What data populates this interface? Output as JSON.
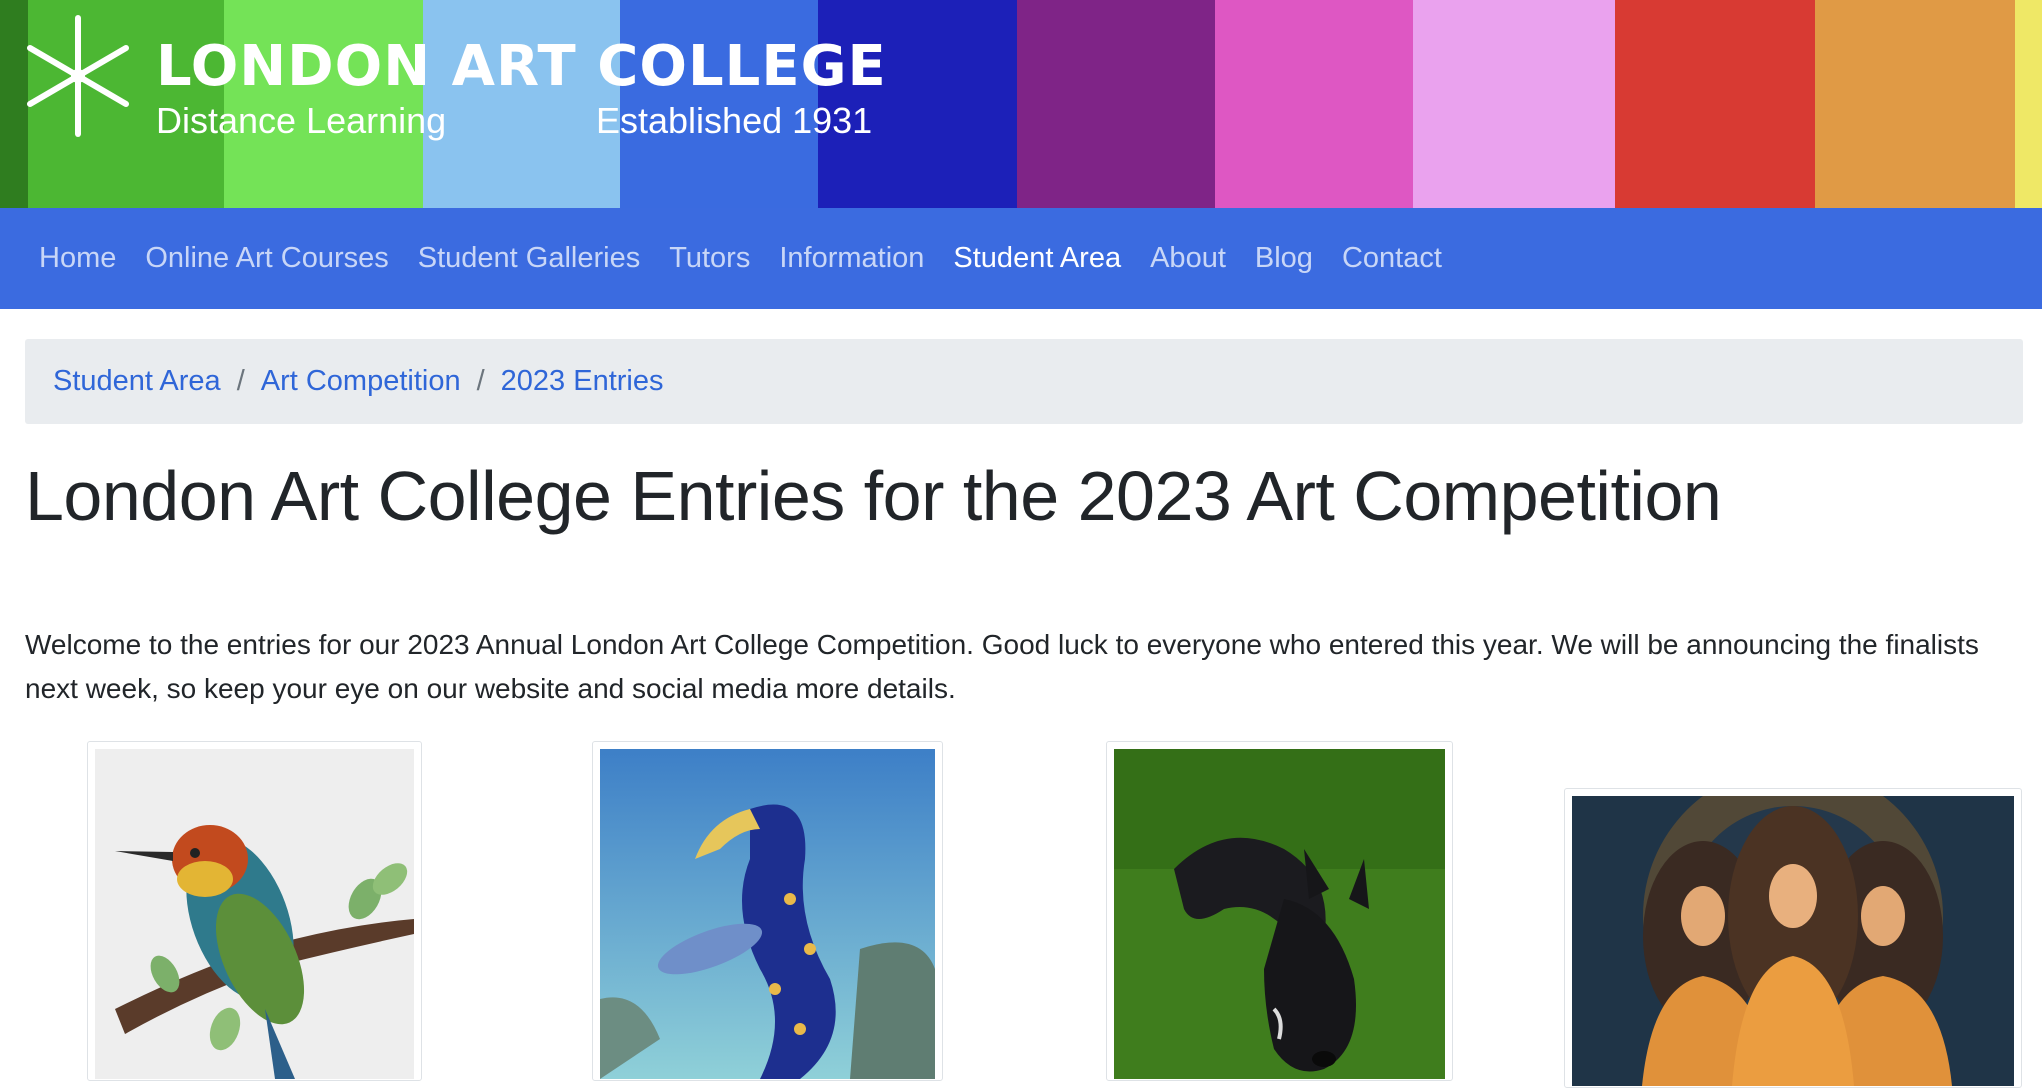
{
  "header": {
    "brand_title": "LONDON ART COLLEGE",
    "brand_subtitle": "Distance Learning",
    "brand_established": "Established 1931",
    "stripe_colors": [
      "#2f7d1f",
      "#4cb733",
      "#74e357",
      "#8ac3ef",
      "#3a6be0",
      "#1c20b8",
      "#7f2487",
      "#de57c3",
      "#eaa2ee",
      "#d83a33",
      "#e09a45",
      "#efe866"
    ]
  },
  "nav": {
    "items": [
      {
        "label": "Home",
        "active": false
      },
      {
        "label": "Online Art Courses",
        "active": false
      },
      {
        "label": "Student Galleries",
        "active": false
      },
      {
        "label": "Tutors",
        "active": false
      },
      {
        "label": "Information",
        "active": false
      },
      {
        "label": "Student Area",
        "active": true
      },
      {
        "label": "About",
        "active": false
      },
      {
        "label": "Blog",
        "active": false
      },
      {
        "label": "Contact",
        "active": false
      }
    ]
  },
  "breadcrumb": {
    "items": [
      "Student Area",
      "Art Competition",
      "2023 Entries"
    ],
    "separator": "/"
  },
  "main": {
    "title": "London Art College Entries for the 2023 Art Competition",
    "intro": "Welcome to the entries for our 2023 Annual London Art College Competition. Good luck to everyone who entered this year. We will be announcing the finalists next week, so keep your eye on our website and social media more details."
  },
  "gallery": {
    "items": [
      {
        "subject": "bird-painting"
      },
      {
        "subject": "sea-creature-painting"
      },
      {
        "subject": "dog-painting"
      },
      {
        "subject": "three-women-painting"
      }
    ]
  }
}
